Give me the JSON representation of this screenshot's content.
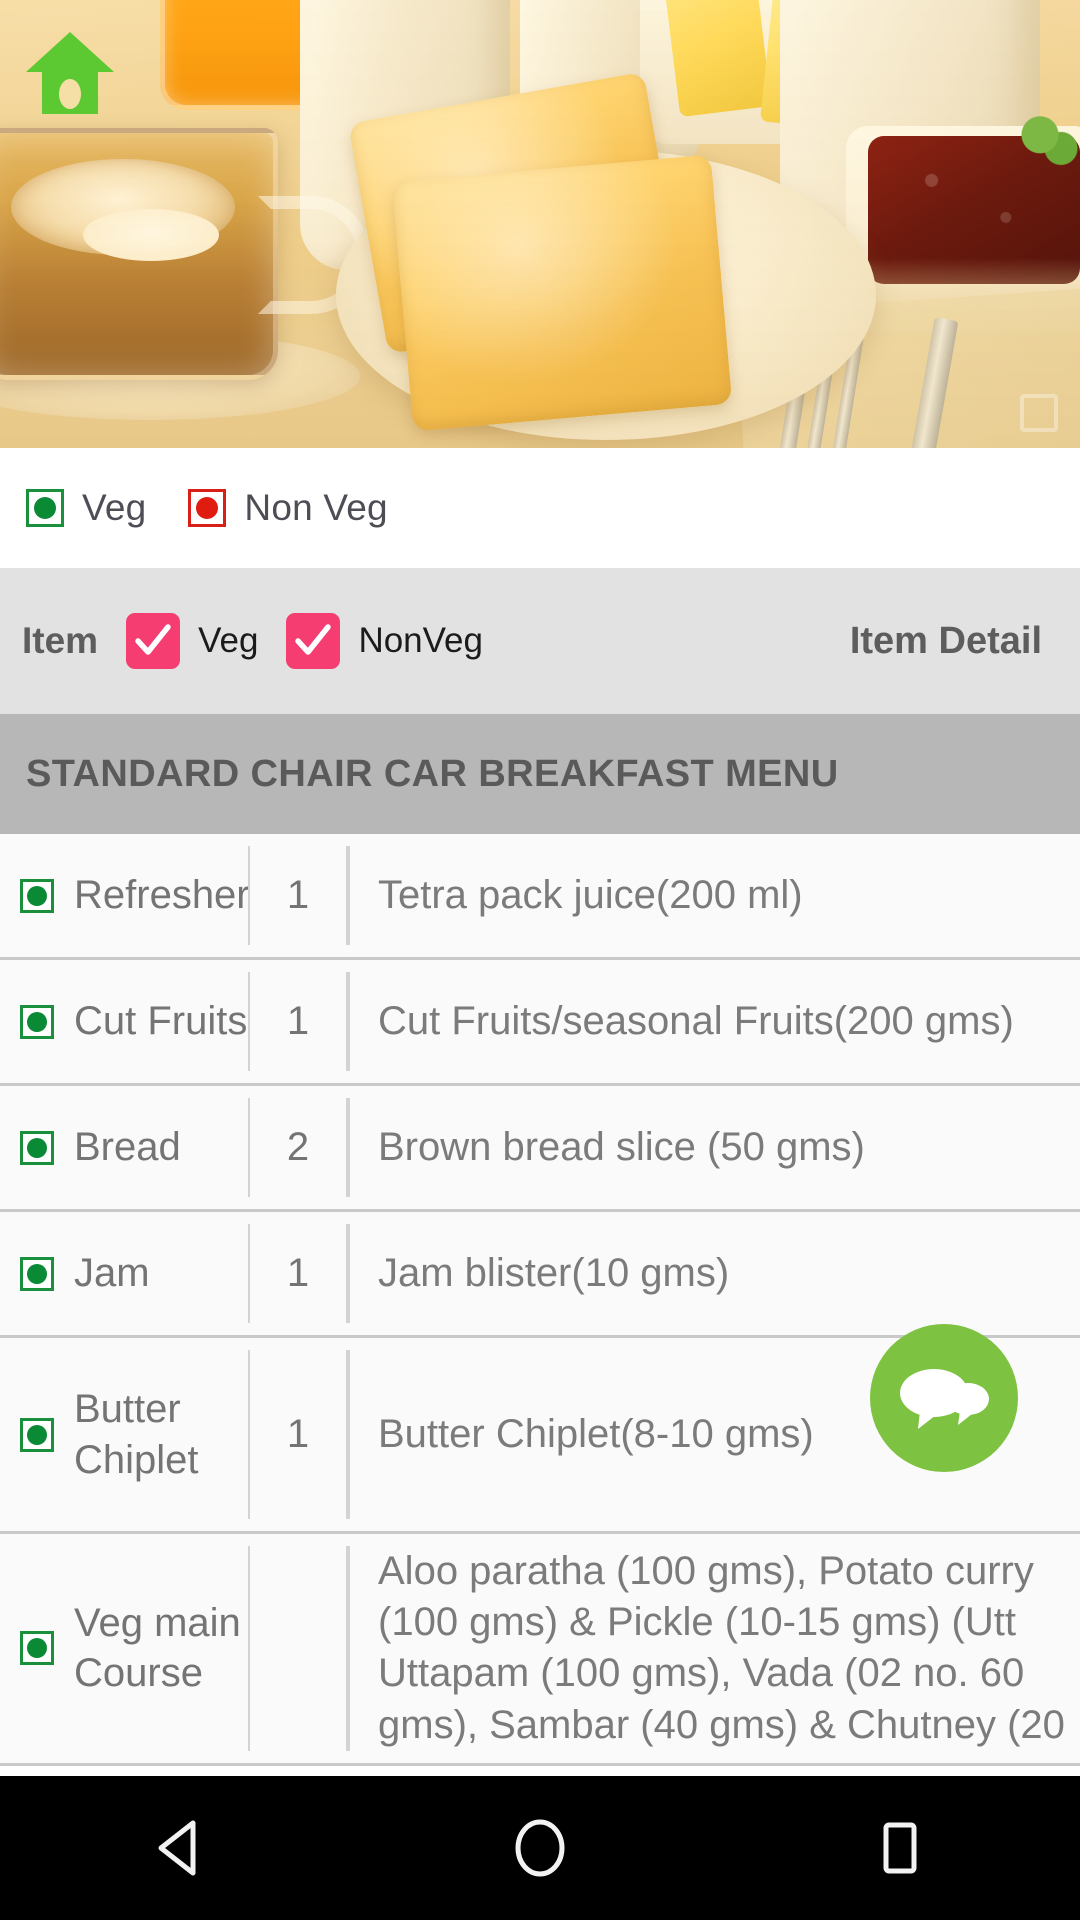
{
  "hero": {
    "home_icon": "home-icon",
    "watermark_icon": "watermark-icon",
    "alt": "Breakfast spread with toast, coffee, juice, butter and jam"
  },
  "legend": {
    "items": [
      {
        "label": "Veg",
        "type": "veg",
        "icon": "veg-marker-icon"
      },
      {
        "label": "Non Veg",
        "type": "nonveg",
        "icon": "nonveg-marker-icon"
      }
    ]
  },
  "filter_bar": {
    "item_label": "Item",
    "veg_checkbox": {
      "label": "Veg",
      "checked": true
    },
    "nonveg_checkbox": {
      "label": "NonVeg",
      "checked": true
    },
    "item_detail_label": "Item Detail"
  },
  "section": {
    "title": "STANDARD CHAIR CAR BREAKFAST MENU"
  },
  "menu_rows": [
    {
      "type": "veg",
      "item": "Refresher",
      "qty": "1",
      "detail": "Tetra pack juice(200 ml)"
    },
    {
      "type": "veg",
      "item": "Cut Fruits",
      "qty": "1",
      "detail": "Cut Fruits/seasonal Fruits(200 gms)"
    },
    {
      "type": "veg",
      "item": "Bread",
      "qty": "2",
      "detail": "Brown bread slice (50 gms)"
    },
    {
      "type": "veg",
      "item": "Jam",
      "qty": "1",
      "detail": "Jam blister(10 gms)"
    },
    {
      "type": "veg",
      "item": "Butter Chiplet",
      "qty": "1",
      "detail": "Butter Chiplet(8-10 gms)"
    },
    {
      "type": "veg",
      "item": "Veg main Course",
      "qty": "",
      "detail": "Aloo paratha (100 gms), Potato curry\n(100 gms) & Pickle (10-15 gms) (Utt\nUttapam (100 gms), Vada (02 no. 60\ngms), Sambar (40 gms) & Chutney (20"
    }
  ],
  "fab": {
    "icon": "chat-bubbles-icon",
    "color": "#7ec242"
  },
  "navbar": {
    "back": "back-triangle-icon",
    "home": "home-circle-icon",
    "recents": "recents-square-icon"
  },
  "colors": {
    "checkbox_pink": "#f63d72",
    "veg_green": "#0b8a36",
    "nonveg_red": "#e01b0f",
    "section_band": "#b7b7b7",
    "filter_band": "#e2e2e2",
    "fab_green": "#7ec242"
  }
}
